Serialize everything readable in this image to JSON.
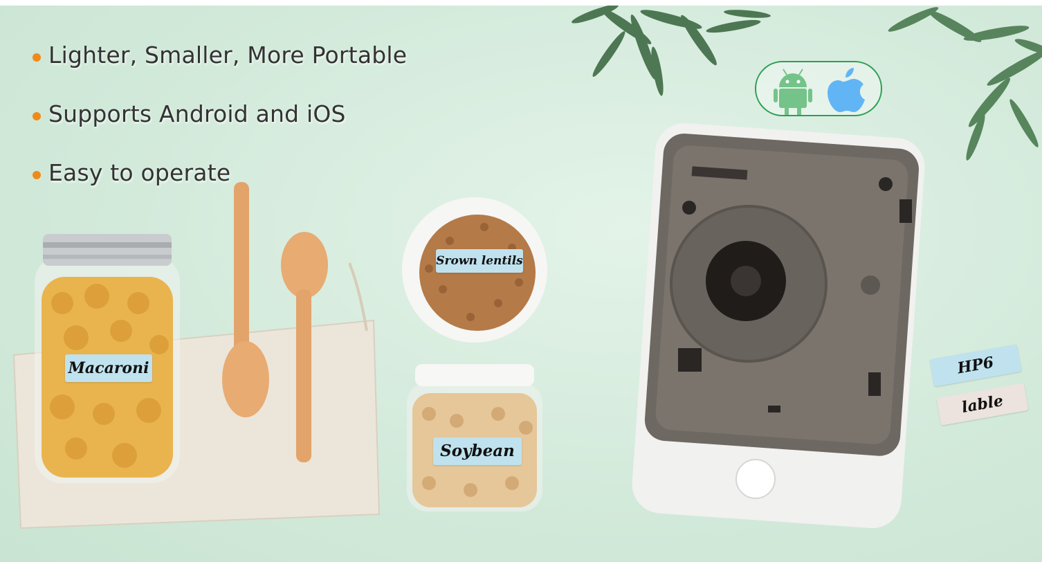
{
  "features": [
    "Lighter, Smaller, More Portable",
    "Supports Android and iOS",
    "Easy to operate"
  ],
  "os_support": {
    "icons": [
      "android-icon",
      "apple-icon"
    ],
    "android_color": "#2aa34a",
    "apple_color": "#0e8ef0"
  },
  "labels": {
    "jar": "Macaroni",
    "bowl": "Srown lentils",
    "small_jar": "Soybean",
    "sample_1": "HP6",
    "sample_2": "lable"
  },
  "colors": {
    "background": "#d6ecdd",
    "bullet": "#f08a18",
    "label_blue": "#bfe2ee",
    "label_beige": "#ece3de"
  }
}
